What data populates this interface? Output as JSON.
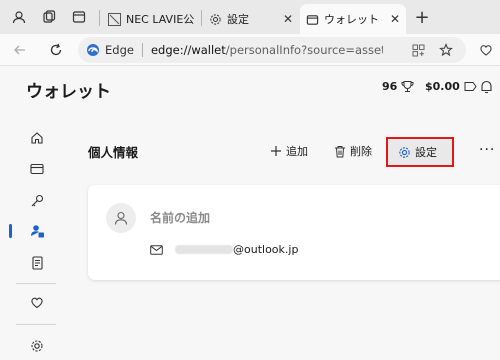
{
  "browser": {
    "tabs": [
      {
        "label": "NEC LAVIE公",
        "active": false
      },
      {
        "label": "設定",
        "active": false
      },
      {
        "label": "ウォレット",
        "active": true
      }
    ],
    "new_tab_symbol": "+",
    "close_symbol": "✕",
    "address": {
      "brand": "Edge",
      "url_host": "edge://wallet",
      "url_path": "/personalInfo?source=assetsSetting..."
    }
  },
  "wallet": {
    "title": "ウォレット",
    "points": "96",
    "cash": "$0.00"
  },
  "section": {
    "title": "個人情報",
    "add_label": "追加",
    "delete_label": "削除",
    "settings_label": "設定",
    "more_symbol": "···"
  },
  "card": {
    "add_name_label": "名前の追加",
    "email_domain": "@outlook.jp"
  },
  "colors": {
    "highlight_border": "#e01818",
    "active_indicator": "#1c62c8",
    "accent_icon": "#1c62c8"
  }
}
